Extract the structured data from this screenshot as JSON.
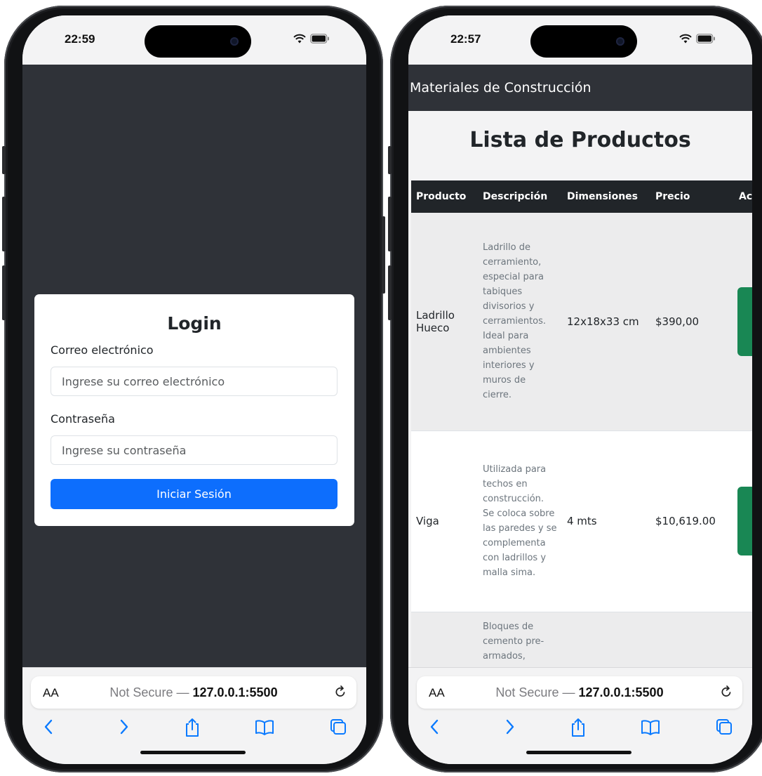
{
  "left_phone": {
    "status": {
      "time": "22:59"
    },
    "login": {
      "title": "Login",
      "email_label": "Correo electrónico",
      "email_placeholder": "Ingrese su correo electrónico",
      "password_label": "Contraseña",
      "password_placeholder": "Ingrese su contraseña",
      "submit_label": "Iniciar Sesión"
    },
    "safari": {
      "aa": "AA",
      "not_secure": "Not Secure —",
      "host": "127.0.0.1:5500"
    }
  },
  "right_phone": {
    "status": {
      "time": "22:57"
    },
    "navbar": {
      "brand": "Materiales de Construcción"
    },
    "page_title": "Lista de Productos",
    "table": {
      "columns": [
        "Producto",
        "Descripción",
        "Dimensiones",
        "Precio",
        "Ac"
      ],
      "rows": [
        {
          "producto": "Ladrillo Hueco",
          "descripcion": "Ladrillo de cerramiento, especial para tabiques divisorios y cerramientos. Ideal para ambientes interiores y muros de cierre.",
          "dimensiones": "12x18x33 cm",
          "precio": "$390,00"
        },
        {
          "producto": "Viga",
          "descripcion": "Utilizada para techos en construcción. Se coloca sobre las paredes y se complementa con ladrillos y malla sima.",
          "dimensiones": "4 mts",
          "precio": "$10,619.00"
        },
        {
          "producto": "",
          "descripcion": "Bloques de cemento pre-armados,",
          "dimensiones": "",
          "precio": ""
        }
      ]
    },
    "safari": {
      "aa": "AA",
      "not_secure": "Not Secure —",
      "host": "127.0.0.1:5500"
    }
  },
  "colors": {
    "navbar_dark": "#2f3238",
    "primary": "#0d6efd",
    "success": "#198754",
    "table_header": "#212529"
  },
  "icons": [
    "wifi-icon",
    "battery-icon",
    "reload-icon",
    "back-icon",
    "forward-icon",
    "share-icon",
    "bookmarks-icon",
    "tabs-icon"
  ]
}
